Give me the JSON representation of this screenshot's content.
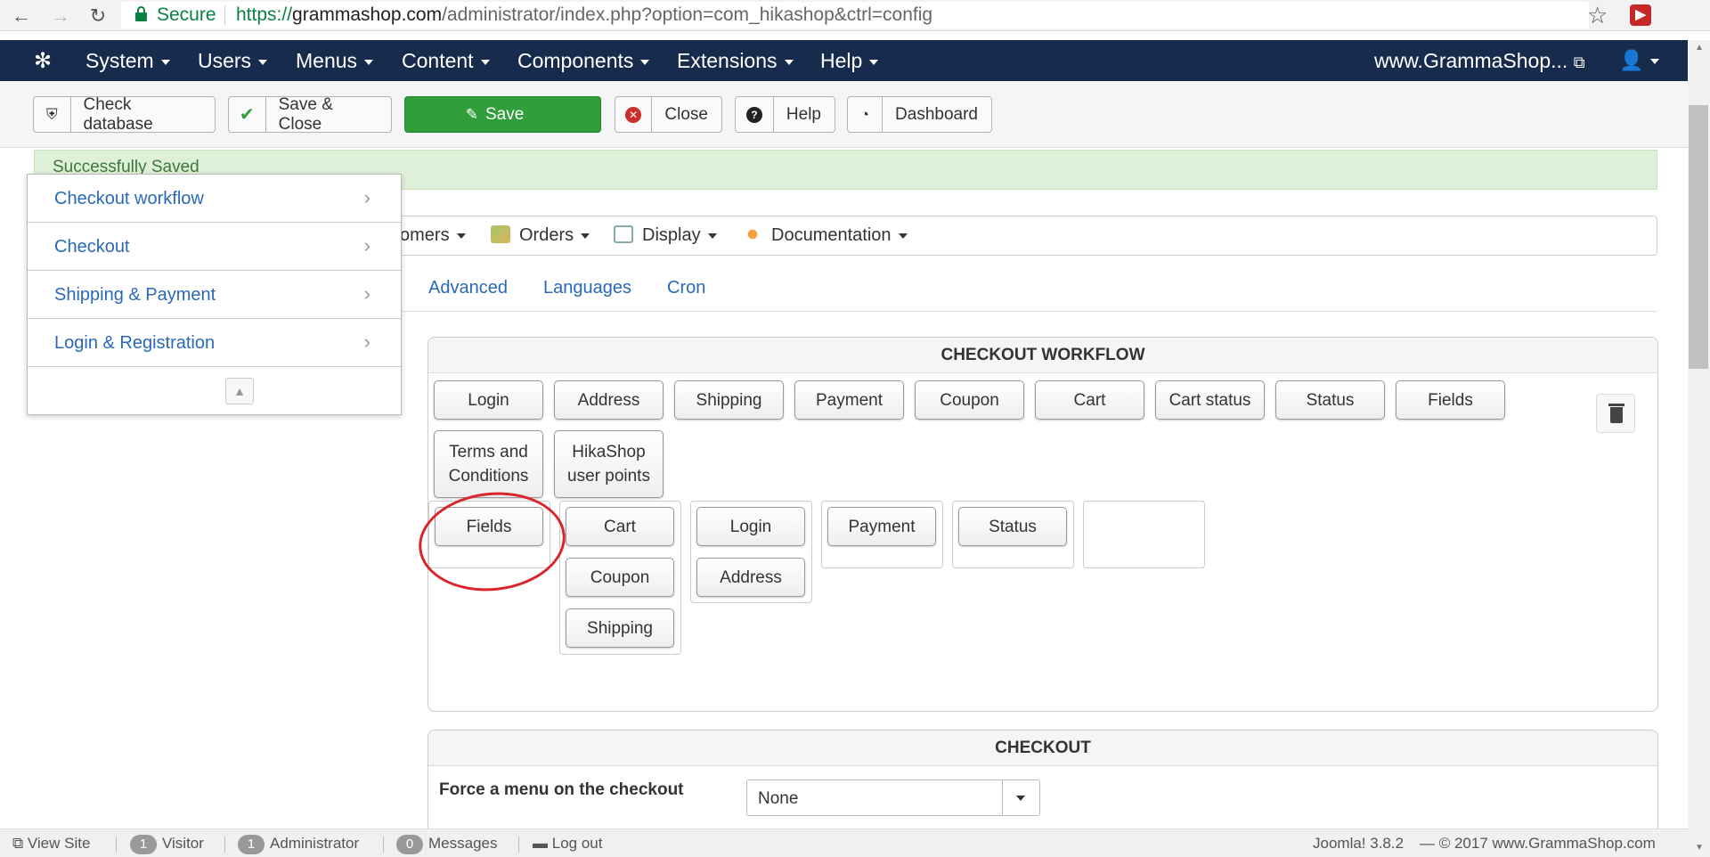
{
  "browser": {
    "secure_label": "Secure",
    "url_protocol": "https://",
    "url_host": "grammashop.com",
    "url_path": "/administrator/index.php?option=com_hikashop&ctrl=config"
  },
  "topnav": {
    "items": [
      "System",
      "Users",
      "Menus",
      "Content",
      "Components",
      "Extensions",
      "Help"
    ],
    "site_link": "www.GrammaShop..."
  },
  "toolbar": {
    "check_database": "Check database",
    "save_close": "Save & Close",
    "save": "Save",
    "close": "Close",
    "help": "Help",
    "dashboard": "Dashboard"
  },
  "alert": {
    "message": "Successfully Saved"
  },
  "subnav": {
    "customers_partial": "omers",
    "orders": "Orders",
    "display": "Display",
    "documentation": "Documentation"
  },
  "tabs": [
    "Advanced",
    "Languages",
    "Cron"
  ],
  "dropdown": {
    "items": [
      "Checkout workflow",
      "Checkout",
      "Shipping & Payment",
      "Login & Registration"
    ]
  },
  "workflow": {
    "title": "CHECKOUT WORKFLOW",
    "available_steps": [
      "Login",
      "Address",
      "Shipping",
      "Payment",
      "Coupon",
      "Cart",
      "Cart status",
      "Status",
      "Fields",
      "Terms and Conditions",
      "HikaShop user points"
    ],
    "columns": [
      [
        "Fields"
      ],
      [
        "Cart",
        "Coupon",
        "Shipping"
      ],
      [
        "Login",
        "Address"
      ],
      [
        "Payment"
      ],
      [
        "Status"
      ],
      []
    ]
  },
  "checkout": {
    "title": "CHECKOUT",
    "force_menu_label": "Force a menu on the checkout",
    "force_menu_value": "None"
  },
  "statusbar": {
    "view_site": "View Site",
    "visitor_count": "1",
    "visitor_label": "Visitor",
    "admin_count": "1",
    "admin_label": "Administrator",
    "messages_count": "0",
    "messages_label": "Messages",
    "logout": "Log out",
    "version": "Joomla! 3.8.2",
    "copyright": "— © 2017 www.GrammaShop.com"
  },
  "colors": {
    "navbar": "#172b4d",
    "save_green": "#2f9e3b",
    "link_blue": "#2a69b8",
    "annotation_red": "#d9262c"
  }
}
